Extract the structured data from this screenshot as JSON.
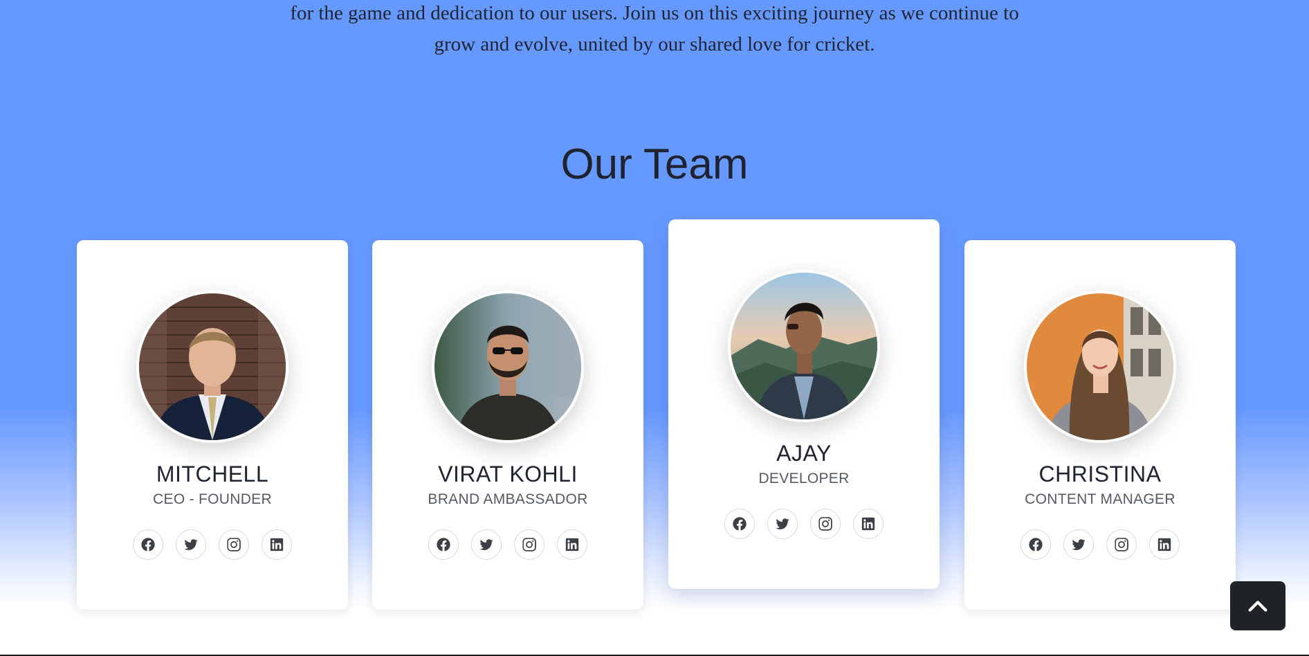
{
  "intro": {
    "line1": "for the game and dedication to our users. Join us on this exciting journey as we continue to",
    "line2": "grow and evolve, united by our shared love for cricket."
  },
  "team": {
    "title": "Our Team",
    "members": [
      {
        "name": "MITCHELL",
        "role": "CEO - FOUNDER",
        "photo": "businessman-portrait-photo",
        "socials": [
          "facebook-icon",
          "twitter-icon",
          "instagram-icon",
          "linkedin-icon"
        ]
      },
      {
        "name": "VIRAT KOHLI",
        "role": "BRAND AMBASSADOR",
        "photo": "man-in-sunglasses-portrait-photo",
        "socials": [
          "facebook-icon",
          "twitter-icon",
          "instagram-icon",
          "linkedin-icon"
        ]
      },
      {
        "name": "AJAY",
        "role": "DEVELOPER",
        "photo": "man-on-mountain-portrait-photo",
        "socials": [
          "facebook-icon",
          "twitter-icon",
          "instagram-icon",
          "linkedin-icon"
        ]
      },
      {
        "name": "CHRISTINA",
        "role": "CONTENT MANAGER",
        "photo": "woman-portrait-photo",
        "socials": [
          "facebook-icon",
          "twitter-icon",
          "instagram-icon",
          "linkedin-icon"
        ]
      }
    ]
  },
  "back_to_top": {
    "icon": "chevron-up-icon"
  },
  "colors": {
    "page_background": "#6699ff",
    "card_background": "#ffffff",
    "back_to_top_background": "#1f2327"
  }
}
